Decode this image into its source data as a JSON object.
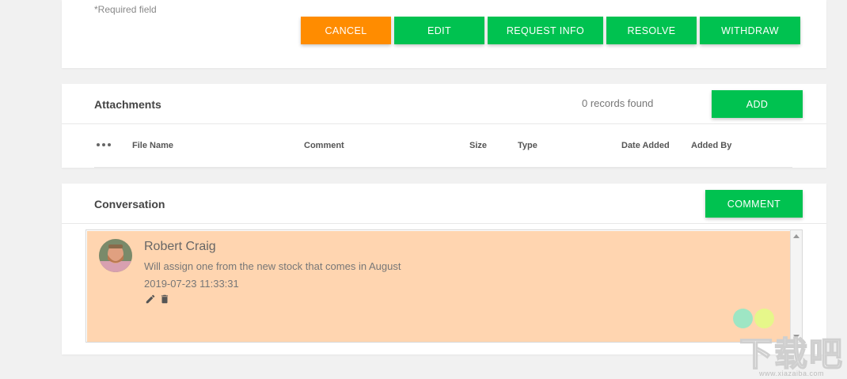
{
  "form": {
    "required_note": "*Required field",
    "actions": [
      {
        "label": "CANCEL",
        "color": "#ff8c00"
      },
      {
        "label": "EDIT",
        "color": "#00c250"
      },
      {
        "label": "REQUEST INFO",
        "color": "#00c250"
      },
      {
        "label": "RESOLVE",
        "color": "#00c250"
      },
      {
        "label": "WITHDRAW",
        "color": "#00c250"
      }
    ]
  },
  "attachments": {
    "title": "Attachments",
    "records_text": "0 records found",
    "add_label": "ADD",
    "columns": [
      "File Name",
      "Comment",
      "Size",
      "Type",
      "Date Added",
      "Added By"
    ]
  },
  "conversation": {
    "title": "Conversation",
    "comment_label": "COMMENT",
    "entries": [
      {
        "author": "Robert Craig",
        "message": "Will assign one from the new stock that comes in August",
        "timestamp": "2019-07-23 11:33:31",
        "highlight_color": "#ffd5b0"
      }
    ]
  },
  "watermark": {
    "big_text": "下载吧",
    "small_text": "www.xiazaiba.com"
  }
}
